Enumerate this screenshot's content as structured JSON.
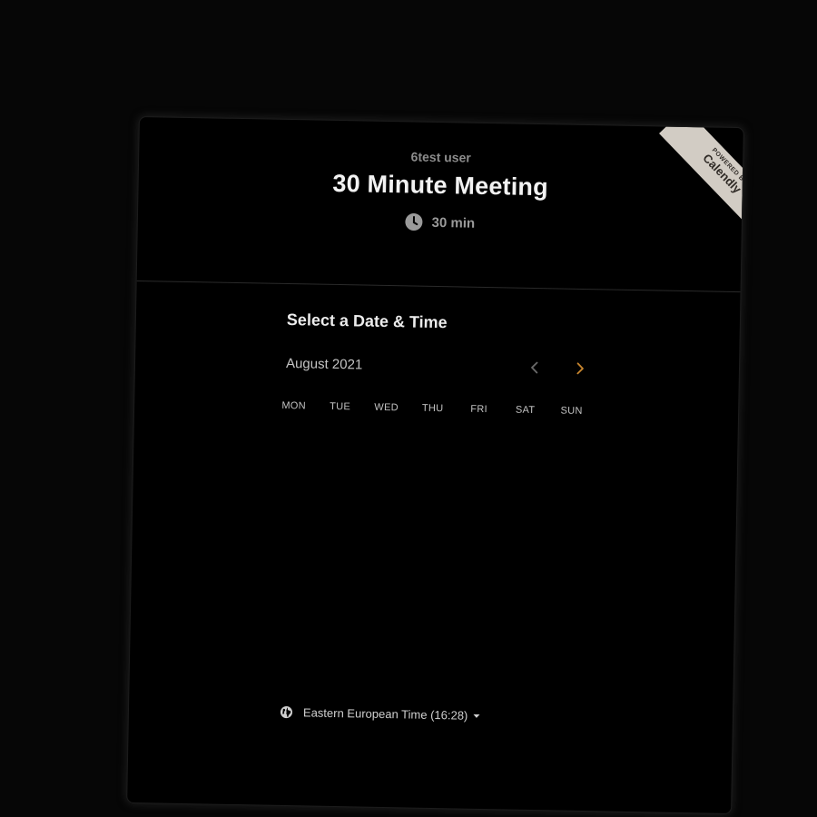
{
  "header": {
    "host_name": "6test user",
    "event_title": "30 Minute Meeting",
    "duration": "30 min",
    "duration_icon": "clock-icon"
  },
  "ribbon": {
    "powered_by": "POWERED BY",
    "brand": "Calendly",
    "color": "#d2ccc4"
  },
  "scheduler": {
    "title": "Select a Date & Time",
    "month": "August 2021",
    "prev_icon": "chevron-left-icon",
    "next_icon": "chevron-right-icon",
    "next_color": "#c8862e",
    "weekdays": [
      "MON",
      "TUE",
      "WED",
      "THU",
      "FRI",
      "SAT",
      "SUN"
    ]
  },
  "timezone": {
    "icon": "globe-icon",
    "label": "Eastern European Time (16:28)",
    "dropdown_icon": "caret-down-icon"
  },
  "colors": {
    "background": "#000000",
    "title_text": "#f2f2f2",
    "muted_text": "#8c8c8c"
  }
}
